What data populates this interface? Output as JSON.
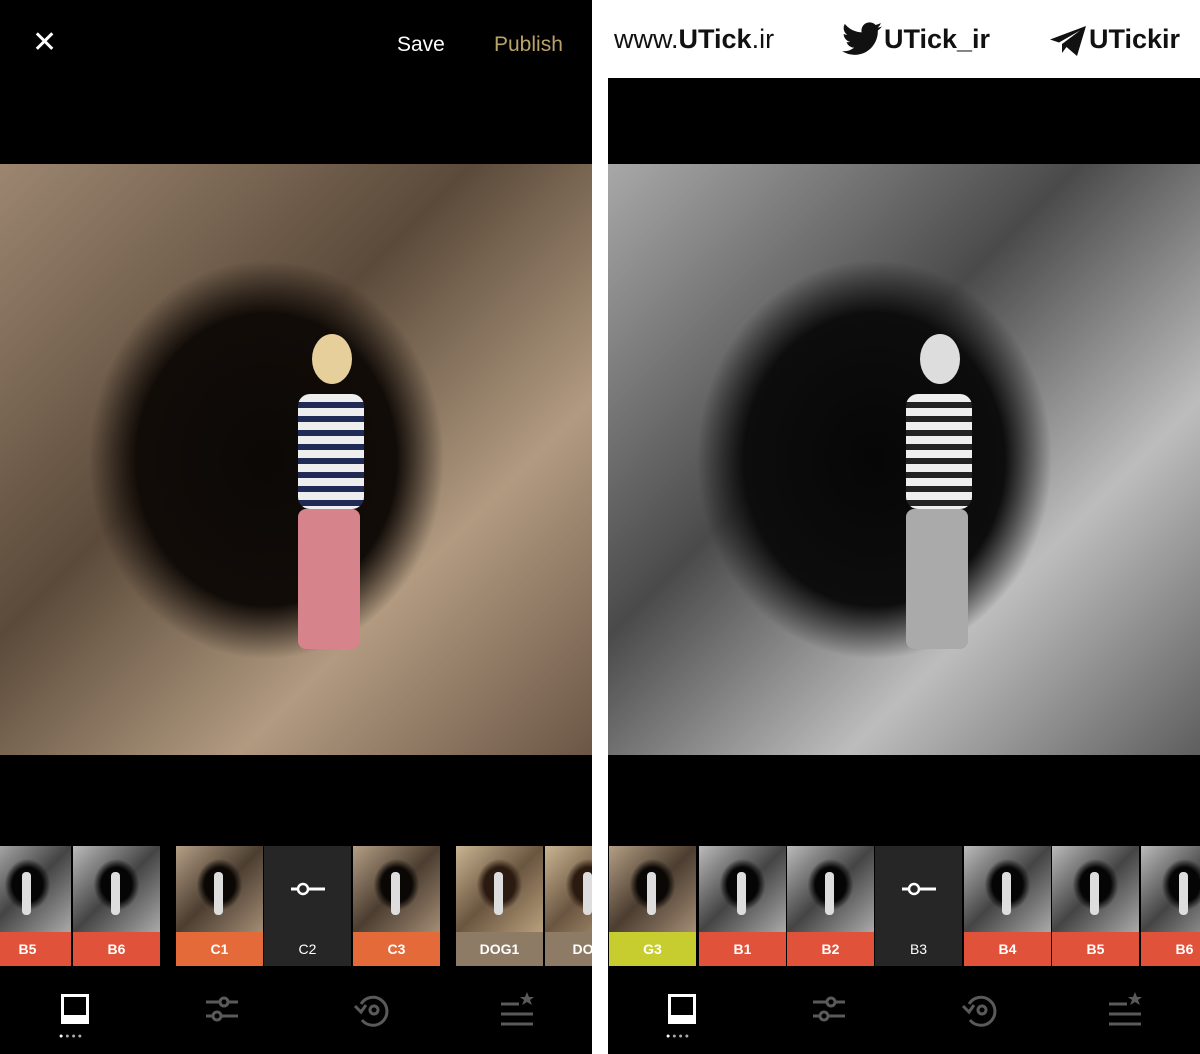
{
  "watermark": {
    "site_prefix": "www.",
    "site_brand": "UTick",
    "site_suffix": ".ir",
    "twitter": "UTick_ir",
    "telegram": "UTickir"
  },
  "left": {
    "header": {
      "close_icon": "close-icon",
      "save_label": "Save",
      "publish_label": "Publish",
      "publish_color": "#b9a36a"
    },
    "presets": [
      {
        "label": "B5",
        "color": "#e0523a",
        "style": "bw"
      },
      {
        "label": "B6",
        "color": "#e0523a",
        "style": "bw"
      },
      {
        "label": "C1",
        "color": "#e56a3a",
        "style": "col"
      },
      {
        "label": "C2",
        "color": "#262626",
        "style": "selected"
      },
      {
        "label": "C3",
        "color": "#e56a3a",
        "style": "col"
      },
      {
        "label": "DOG1",
        "color": "#8e7b66",
        "style": "warm"
      },
      {
        "label": "DOG",
        "color": "#8e7b66",
        "style": "warm"
      }
    ]
  },
  "right": {
    "presets": [
      {
        "label": "G3",
        "color": "#c7cd2f",
        "style": "col"
      },
      {
        "label": "B1",
        "color": "#e0523a",
        "style": "bw"
      },
      {
        "label": "B2",
        "color": "#e0523a",
        "style": "bw"
      },
      {
        "label": "B3",
        "color": "#262626",
        "style": "selected"
      },
      {
        "label": "B4",
        "color": "#e0523a",
        "style": "bw"
      },
      {
        "label": "B5",
        "color": "#e0523a",
        "style": "bw"
      },
      {
        "label": "B6",
        "color": "#e0523a",
        "style": "bw"
      }
    ]
  },
  "nav": [
    {
      "icon": "presets-frame-icon",
      "active": true
    },
    {
      "icon": "adjust-sliders-icon",
      "active": false
    },
    {
      "icon": "history-revert-icon",
      "active": false
    },
    {
      "icon": "recipes-star-list-icon",
      "active": false
    }
  ]
}
